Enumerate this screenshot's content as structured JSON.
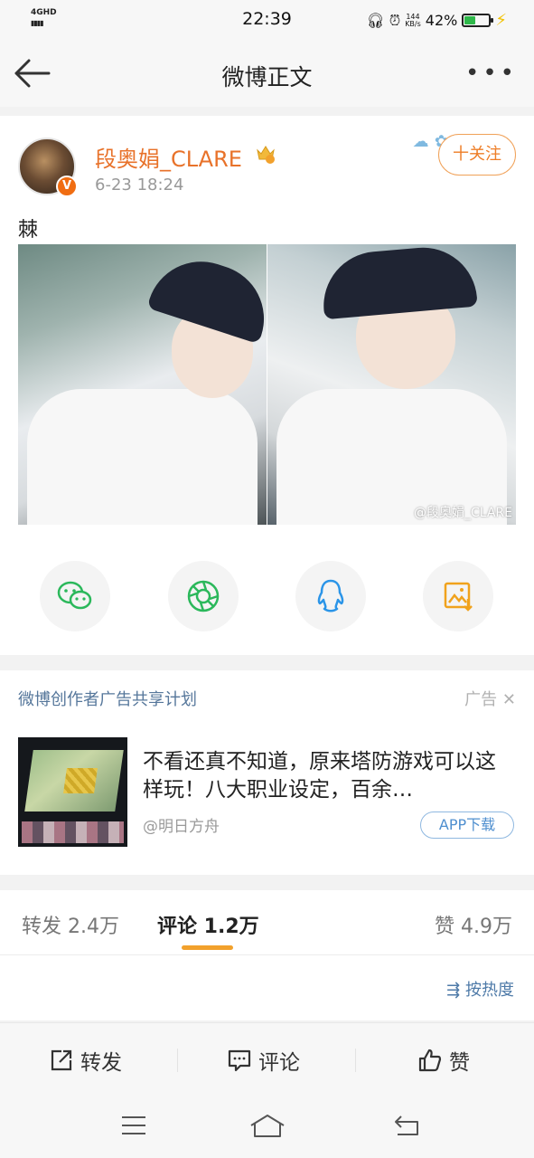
{
  "status_bar": {
    "network": "4GHD",
    "time": "22:39",
    "speed_value": "144",
    "speed_unit": "KB/s",
    "battery": "42%",
    "battery_level": 0.42,
    "battery_color": "#2fb84a"
  },
  "nav": {
    "title": "微博正文"
  },
  "post": {
    "username": "段奥娟_CLARE",
    "time": "6-23 18:24",
    "follow_label": "十关注",
    "text": "棘",
    "watermark": "@段奥娟_CLARE",
    "accent": "#e8722a"
  },
  "share": [
    {
      "name": "wechat-icon",
      "color": "#2bb85b"
    },
    {
      "name": "moments-icon",
      "color": "#2bb85b"
    },
    {
      "name": "qq-icon",
      "color": "#2b95e8"
    },
    {
      "name": "save-image-icon",
      "color": "#f0a21c"
    }
  ],
  "ad": {
    "header": "微博创作者广告共享计划",
    "tag": "广告",
    "title": "不看还真不知道，原来塔防游戏可以这样玩！八大职业设定，百余…",
    "source": "@明日方舟",
    "app_button": "APP下载"
  },
  "tabs": {
    "repost": "转发 2.4万",
    "comment": "评论 1.2万",
    "like": "赞 4.9万",
    "sort": "按热度"
  },
  "actions": {
    "repost": "转发",
    "comment": "评论",
    "like": "赞"
  }
}
